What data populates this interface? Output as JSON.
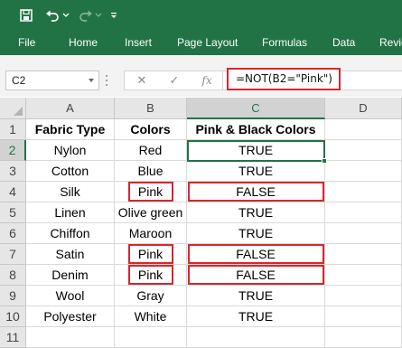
{
  "quick_access": {
    "save_icon": "save-icon",
    "undo_icon": "undo-icon",
    "undo_dropdown_icon": "chevron-down-icon",
    "redo_icon": "redo-icon",
    "customize_icon": "customize-toolbar-icon"
  },
  "ribbon": {
    "tabs": [
      {
        "label": "File"
      },
      {
        "label": "Home"
      },
      {
        "label": "Insert"
      },
      {
        "label": "Page Layout"
      },
      {
        "label": "Formulas"
      },
      {
        "label": "Data"
      },
      {
        "label": "Revie"
      }
    ]
  },
  "formula_bar": {
    "name_box": "C2",
    "cancel_symbol": "✕",
    "enter_symbol": "✓",
    "function_symbol": "fx",
    "formula": "=NOT(B2=\"Pink\")"
  },
  "sheet": {
    "columns": [
      "A",
      "B",
      "C",
      "D"
    ],
    "active_column": "C",
    "active_row": "2",
    "active_cell": "C2",
    "rows": [
      {
        "num": "1",
        "a": "Fabric Type",
        "b": "Colors",
        "c": "Pink & Black Colors"
      },
      {
        "num": "2",
        "a": "Nylon",
        "b": "Red",
        "c": "TRUE"
      },
      {
        "num": "3",
        "a": "Cotton",
        "b": "Blue",
        "c": "TRUE"
      },
      {
        "num": "4",
        "a": "Silk",
        "b": "Pink",
        "c": "FALSE"
      },
      {
        "num": "5",
        "a": "Linen",
        "b": "Olive green",
        "c": "TRUE"
      },
      {
        "num": "6",
        "a": "Chiffon",
        "b": "Maroon",
        "c": "TRUE"
      },
      {
        "num": "7",
        "a": "Satin",
        "b": "Pink",
        "c": "FALSE"
      },
      {
        "num": "8",
        "a": "Denim",
        "b": "Pink",
        "c": "FALSE"
      },
      {
        "num": "9",
        "a": "Wool",
        "b": "Gray",
        "c": "TRUE"
      },
      {
        "num": "10",
        "a": "Polyester",
        "b": "White",
        "c": "TRUE"
      },
      {
        "num": "11",
        "a": "",
        "b": "",
        "c": ""
      }
    ]
  },
  "colors": {
    "excel_green": "#217346",
    "highlight_red": "#d9262c"
  }
}
